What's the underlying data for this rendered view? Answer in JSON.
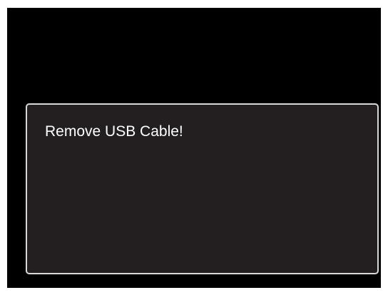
{
  "dialog": {
    "message": "Remove USB Cable!"
  },
  "colors": {
    "screen_background": "#000000",
    "dialog_background": "#231f20",
    "dialog_border": "#d9d9d9",
    "text": "#ffffff"
  }
}
